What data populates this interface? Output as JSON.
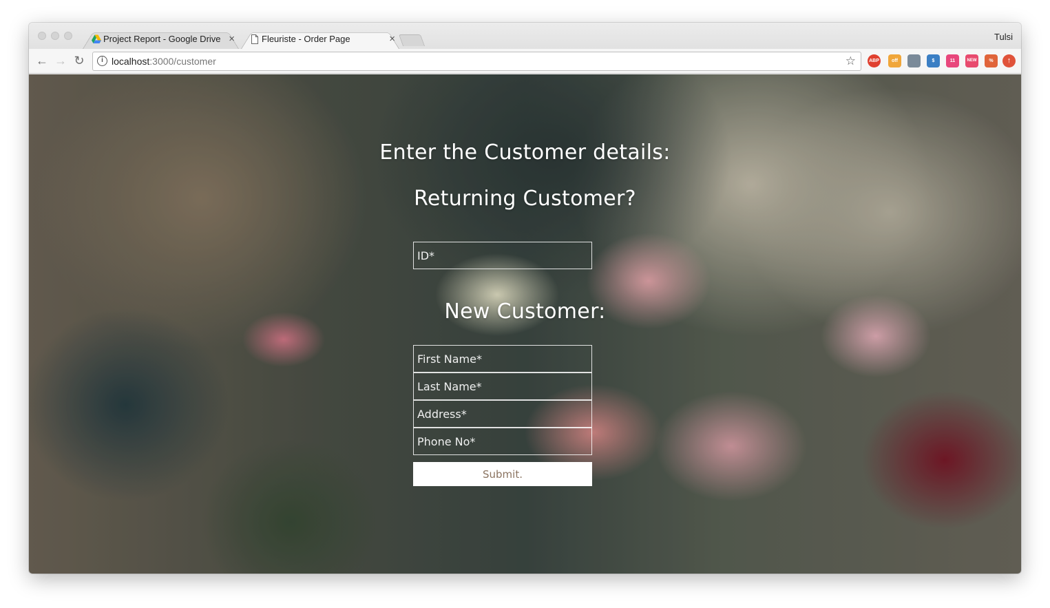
{
  "browser": {
    "tabs": [
      {
        "title": "Project Report - Google Drive",
        "icon": "google-drive-icon",
        "active": false
      },
      {
        "title": "Fleuriste - Order Page",
        "icon": "page-icon",
        "active": true
      }
    ],
    "close_glyph": "×",
    "profile_name": "Tulsi",
    "url_host": "localhost",
    "url_path": ":3000/customer",
    "extensions": [
      {
        "icon": "adblock-plus-icon",
        "label": "ABP",
        "color": "#e0402f"
      },
      {
        "icon": "coupon-off-icon",
        "label": "off",
        "color": "#f0a63a"
      },
      {
        "icon": "puzzle-icon",
        "label": "",
        "color": "#7a8a99"
      },
      {
        "icon": "dollar-icon",
        "label": "$",
        "color": "#3b7fc4"
      },
      {
        "icon": "calendar-11-icon",
        "label": "11",
        "color": "#e8477c"
      },
      {
        "icon": "new-badge-icon",
        "label": "NEW",
        "color": "#e84b6e"
      },
      {
        "icon": "translate-icon",
        "label": "%",
        "color": "#e0643a"
      },
      {
        "icon": "upload-icon",
        "label": "↑",
        "color": "#e0533a"
      }
    ]
  },
  "page": {
    "heading": "Enter the Customer details:",
    "returning_heading": "Returning Customer?",
    "id_placeholder": "ID*",
    "new_heading": "New Customer:",
    "first_name_placeholder": "First Name*",
    "last_name_placeholder": "Last Name*",
    "address_placeholder": "Address*",
    "phone_placeholder": "Phone No*",
    "submit_label": "Submit."
  }
}
